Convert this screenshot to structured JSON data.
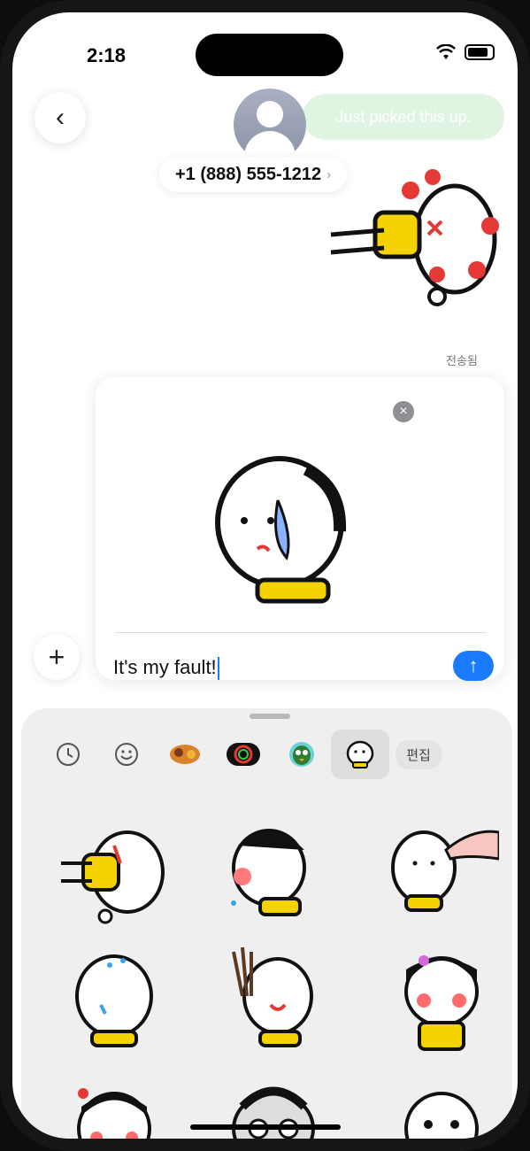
{
  "status_bar": {
    "time": "2:18"
  },
  "header": {
    "contact_name": "+1 (888) 555-1212"
  },
  "messages": [
    {
      "text": "Just picked this up."
    }
  ],
  "delivery_status": "전송됨",
  "compose": {
    "text": "It's my fault!"
  },
  "sticker_tray": {
    "edit_label": "편집"
  },
  "colors": {
    "accent": "#1a7bff",
    "bubble_green": "#dff5e0",
    "tray_bg": "#efefef"
  }
}
